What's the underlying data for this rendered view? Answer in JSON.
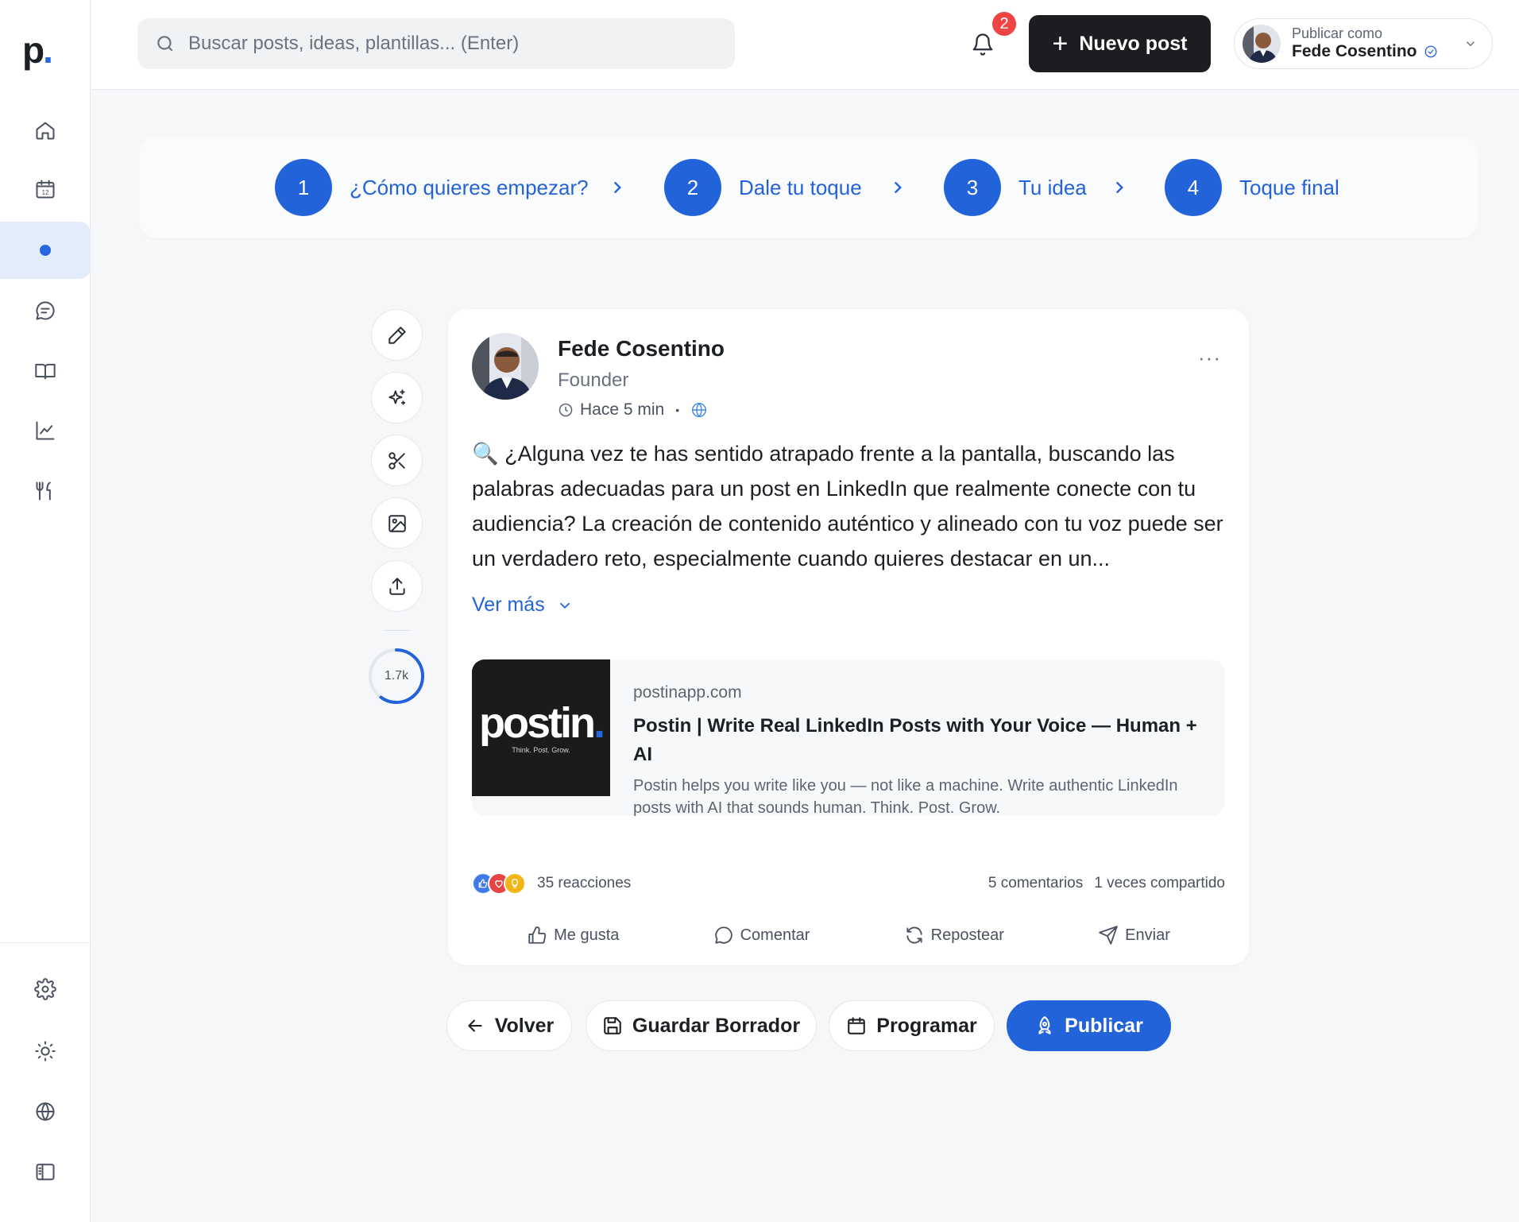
{
  "brand": {
    "logo_letter": "p",
    "logo_dot": "."
  },
  "colors": {
    "accent": "#2363d9",
    "dark_button": "#1c1d20",
    "badge": "#ef4444"
  },
  "sidebar": {
    "items": [
      {
        "icon": "home-icon"
      },
      {
        "icon": "calendar-icon",
        "badge_text": "12"
      },
      {
        "icon": "dot-icon",
        "active": true
      },
      {
        "icon": "chat-icon"
      },
      {
        "icon": "book-icon"
      },
      {
        "icon": "chart-icon"
      },
      {
        "icon": "utensils-icon"
      }
    ],
    "bottom_items": [
      {
        "icon": "gear-icon"
      },
      {
        "icon": "sun-icon"
      },
      {
        "icon": "globe-icon"
      },
      {
        "icon": "sidebar-toggle-icon"
      }
    ]
  },
  "header": {
    "search_placeholder": "Buscar posts, ideas, plantillas... (Enter)",
    "notification_count": "2",
    "new_post_label": "Nuevo post",
    "publish_as_label": "Publicar como",
    "publish_as_name": "Fede Cosentino"
  },
  "stepper": {
    "steps": [
      {
        "number": "1",
        "label": "¿Cómo quieres empezar?"
      },
      {
        "number": "2",
        "label": "Dale tu toque"
      },
      {
        "number": "3",
        "label": "Tu idea"
      },
      {
        "number": "4",
        "label": "Toque final"
      }
    ]
  },
  "tools": {
    "items": [
      "pencil-icon",
      "sparkles-icon",
      "scissors-icon",
      "image-icon",
      "upload-icon"
    ],
    "counter_label": "1.7k",
    "counter_progress": 0.6
  },
  "post": {
    "author": "Fede Cosentino",
    "role": "Founder",
    "time": "Hace 5 min",
    "separator": "•",
    "more": "···",
    "body": "🔍 ¿Alguna vez te has sentido atrapado frente a la pantalla, buscando las palabras adecuadas para un post en LinkedIn que realmente conecte con tu audiencia? La creación de contenido auténtico y alineado con tu voz puede ser un verdadero reto, especialmente cuando quieres destacar en un...",
    "see_more": "Ver más",
    "link": {
      "thumb_brand": "postin",
      "thumb_brand_dot": ".",
      "thumb_tagline": "Think. Post. Grow.",
      "domain": "postinapp.com",
      "title": "Postin | Write Real LinkedIn Posts with Your Voice — Human + AI",
      "description": "Postin helps you write like you — not like a machine. Write authentic LinkedIn posts with AI that sounds human. Think. Post. Grow."
    },
    "reactions_count": "35 reacciones",
    "comments": "5 comentarios",
    "shares": "1 veces compartido",
    "actions": {
      "like": "Me gusta",
      "comment": "Comentar",
      "repost": "Repostear",
      "send": "Enviar"
    }
  },
  "footer_buttons": {
    "back": "Volver",
    "save_draft": "Guardar Borrador",
    "schedule": "Programar",
    "publish": "Publicar"
  }
}
